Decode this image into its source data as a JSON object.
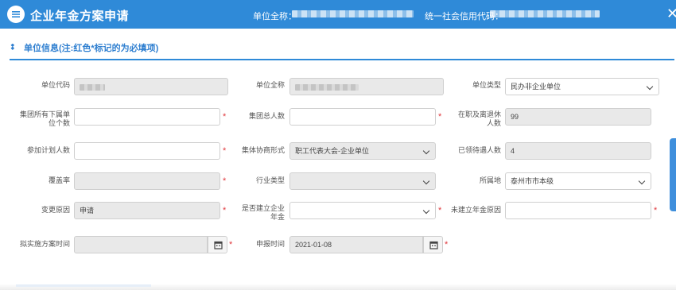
{
  "header": {
    "title": "企业年金方案申请",
    "unit_name_label": "单位全称：",
    "credit_code_label": "统一社会信用代码：",
    "close_glyph": "✕"
  },
  "section": {
    "title": "单位信息(注:红色*标记的为必填项)"
  },
  "form": {
    "unit_code_label": "单位代码",
    "unit_name_label": "单位全称",
    "unit_type_label": "单位类型",
    "unit_type_value": "民办非企业单位",
    "subunit_count_label": "集团所有下属单位个数",
    "group_total_label": "集团总人数",
    "active_retired_label": "在职及离退休人数",
    "active_retired_value": "99",
    "participants_label": "参加计划人数",
    "negotiation_label": "集体协商形式",
    "negotiation_value": "职工代表大会-企业单位",
    "pension_receivers_label": "已领待遇人数",
    "pension_receivers_value": "4",
    "coverage_label": "覆盖率",
    "industry_label": "行业类型",
    "location_label": "所属地",
    "location_value": "泰州市市本级",
    "change_reason_label": "变更原因",
    "change_reason_value": "申请",
    "established_label": "是否建立企业年金",
    "not_established_label": "未建立年金原因",
    "plan_time_label": "拟实施方案时间",
    "apply_time_label": "申报时间",
    "apply_time_value": "2021-01-08",
    "required_mark": "*"
  },
  "colors": {
    "header_bg": "#2f8ad8",
    "accent": "#2f7fd0",
    "required": "#e0393e",
    "readonly_bg": "#e9e9e9"
  },
  "icons": [
    "list-icon",
    "close-icon",
    "diamond-icon",
    "calendar-icon",
    "chevron-down-icon"
  ]
}
